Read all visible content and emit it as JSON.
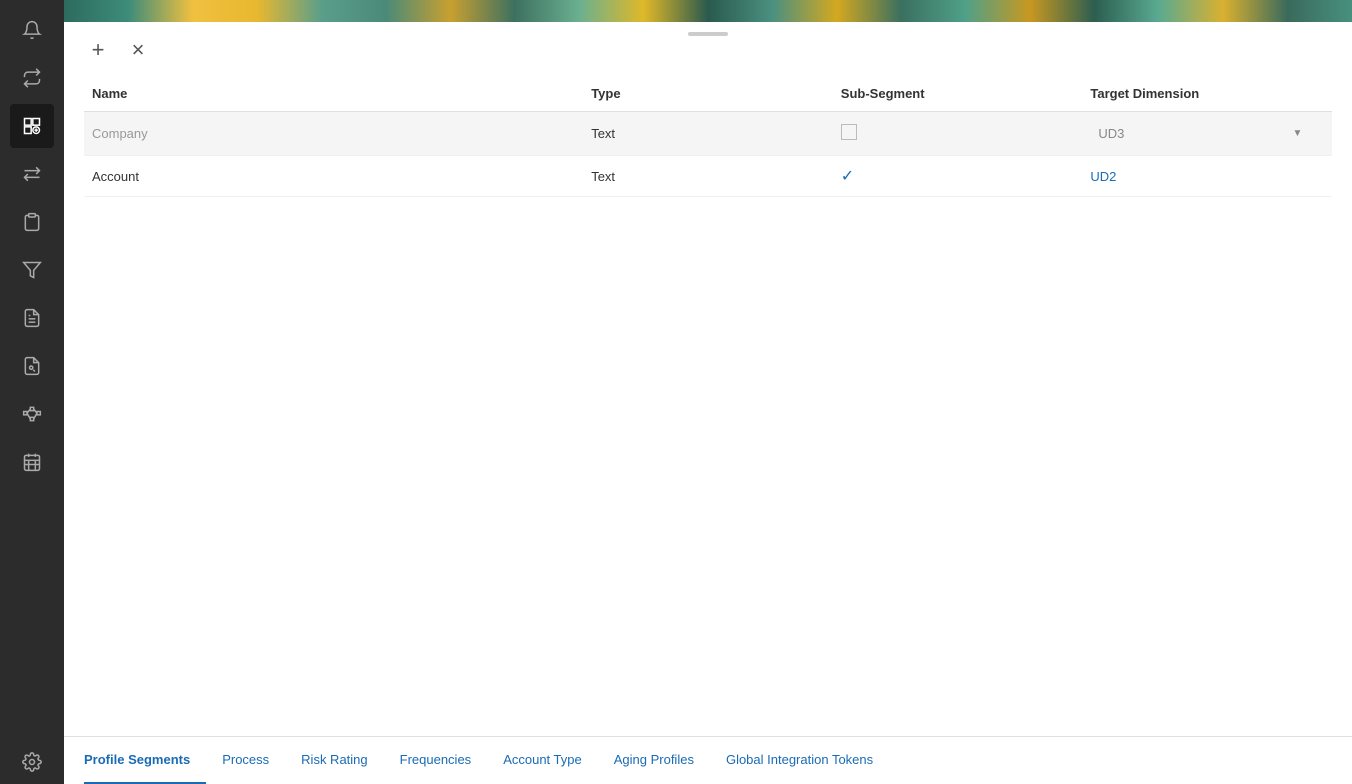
{
  "sidebar": {
    "icons": [
      {
        "name": "bell-icon",
        "symbol": "🔔"
      },
      {
        "name": "refresh-icon",
        "symbol": "⇄"
      },
      {
        "name": "profile-settings-icon",
        "symbol": "⚙",
        "active": true
      },
      {
        "name": "arrows-icon",
        "symbol": "⇌"
      },
      {
        "name": "clipboard-icon",
        "symbol": "📋"
      },
      {
        "name": "filter-icon",
        "symbol": "▽"
      },
      {
        "name": "document-icon",
        "symbol": "📄"
      },
      {
        "name": "report-eye-icon",
        "symbol": "📊"
      },
      {
        "name": "hierarchy-icon",
        "symbol": "⊞"
      },
      {
        "name": "calendar-grid-icon",
        "symbol": "⊟"
      },
      {
        "name": "settings-gear-icon",
        "symbol": "⚙"
      }
    ]
  },
  "toolbar": {
    "add_label": "+",
    "remove_label": "×"
  },
  "table": {
    "columns": [
      "Name",
      "Type",
      "Sub-Segment",
      "Target Dimension"
    ],
    "rows": [
      {
        "name": "Company",
        "name_placeholder": "Company",
        "type": "Text",
        "sub_segment": "inactive",
        "target_dimension": "UD3",
        "highlighted": true
      },
      {
        "name": "Account",
        "name_placeholder": "",
        "type": "Text",
        "sub_segment": "active",
        "target_dimension": "UD2",
        "highlighted": false
      }
    ]
  },
  "tabs": [
    {
      "id": "profile-segments",
      "label": "Profile Segments",
      "active": true
    },
    {
      "id": "process",
      "label": "Process",
      "active": false
    },
    {
      "id": "risk-rating",
      "label": "Risk Rating",
      "active": false
    },
    {
      "id": "frequencies",
      "label": "Frequencies",
      "active": false
    },
    {
      "id": "account-type",
      "label": "Account Type",
      "active": false
    },
    {
      "id": "aging-profiles",
      "label": "Aging Profiles",
      "active": false
    },
    {
      "id": "global-integration-tokens",
      "label": "Global Integration Tokens",
      "active": false
    }
  ]
}
